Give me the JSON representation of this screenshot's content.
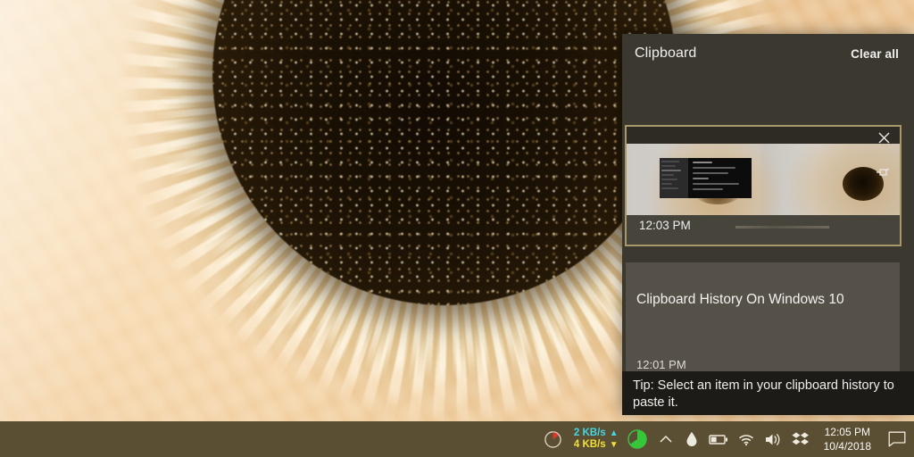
{
  "desktop": {
    "wallpaper_description": "macro photo of cream-peach gerbera daisy with dark center",
    "colors": {
      "petal_light": "#f7dcb4",
      "petal_mid": "#eec795",
      "flower_center": "#1c1205",
      "taskbar": "#5a4e33"
    }
  },
  "clipboard": {
    "title": "Clipboard",
    "clear_all_label": "Clear all",
    "accent_selected_border": "#a89868",
    "panel_bg": "#3b382f",
    "item_bg": "#555148",
    "items": [
      {
        "type": "image",
        "timestamp": "12:03 PM",
        "close_icon": "close-icon",
        "pin_icon": "pin-icon",
        "selected": true,
        "description": "screenshot thumbnail of a dark settings window over flower wallpaper"
      },
      {
        "type": "text",
        "text": "Clipboard History On Windows 10",
        "timestamp": "12:01 PM",
        "selected": false
      },
      {
        "type": "partial",
        "text": "",
        "selected": false
      }
    ],
    "tip": "Tip: Select an item in your clipboard history to paste it."
  },
  "taskbar": {
    "disk_gauge": {
      "icon": "disk-gauge-icon",
      "wedge_color": "#d93a2b"
    },
    "network": {
      "upload": "2 KB/s",
      "upload_arrow": "▲",
      "upload_color": "#45d6e2",
      "download": "4 KB/s",
      "download_arrow": "▼",
      "download_color": "#f2e03a"
    },
    "cpu_gauge": {
      "icon": "cpu-gauge-icon",
      "fill_color": "#35c639"
    },
    "icons": [
      {
        "name": "chevron-up-icon",
        "label": "Show hidden icons"
      },
      {
        "name": "water-drop-icon",
        "label": "f.lux"
      },
      {
        "name": "battery-icon",
        "label": "Battery"
      },
      {
        "name": "wifi-icon",
        "label": "Network"
      },
      {
        "name": "volume-icon",
        "label": "Volume"
      },
      {
        "name": "dropbox-icon",
        "label": "Dropbox"
      }
    ],
    "clock": {
      "time": "12:05 PM",
      "date": "10/4/2018"
    },
    "action_center_icon": "action-center-icon"
  }
}
